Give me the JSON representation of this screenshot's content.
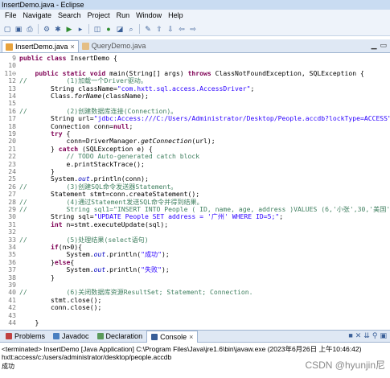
{
  "window": {
    "title": "InsertDemo.java - Eclipse"
  },
  "menu": [
    "File",
    "Navigate",
    "Search",
    "Project",
    "Run",
    "Window",
    "Help"
  ],
  "toolbar": {
    "icons": [
      "new-icon",
      "save-icon",
      "print-icon",
      "build-icon",
      "debug-icon",
      "run-icon",
      "external-tools-icon",
      "new-package-icon",
      "new-class-icon",
      "open-type-icon",
      "search-icon",
      "edit-icon",
      "prev-annotation-icon",
      "next-annotation-icon",
      "back-icon",
      "forward-icon"
    ]
  },
  "editor_tabs": [
    {
      "label": "InsertDemo.java",
      "active": true
    },
    {
      "label": "QueryDemo.java",
      "active": false
    }
  ],
  "code_lines": [
    {
      "n": "9",
      "html": "<span class=\"kw\">public class</span> InsertDemo {"
    },
    {
      "n": "10",
      "html": ""
    },
    {
      "n": "11⊖",
      "html": "    <span class=\"kw\">public static void</span> main(String[] args) <span class=\"kw\">throws</span> ClassNotFoundException, SQLException {"
    },
    {
      "n": "12",
      "html": "<span class=\"cm\">//          (1)加载一个Driver驱动。</span>"
    },
    {
      "n": "13",
      "html": "        String <span class=\"fld\" style=\"font-style:normal;color:#000\">className</span>=<span class=\"st\">\"com.hxtt.sql.access.AccessDriver\"</span>;"
    },
    {
      "n": "14",
      "html": "        Class.<span class=\"mth\">forName</span>(className);"
    },
    {
      "n": "15",
      "html": ""
    },
    {
      "n": "16",
      "html": "<span class=\"cm\">//          (2)创建数据库连接(Connection)。</span>"
    },
    {
      "n": "17",
      "html": "        String url=<span class=\"st\">\"jdbc:Access:///C:/Users/Administrator/Desktop/People.accdb?lockType=ACCESS\"</span>;"
    },
    {
      "n": "18",
      "html": "        Connection conn=<span class=\"kw\">null</span>;"
    },
    {
      "n": "19",
      "html": "        <span class=\"kw\">try</span> {"
    },
    {
      "n": "20",
      "html": "            conn=DriverManager.<span class=\"mth\">getConnection</span>(url);"
    },
    {
      "n": "21",
      "html": "        } <span class=\"kw\">catch</span> (SQLException e) {"
    },
    {
      "n": "22",
      "html": "            <span class=\"cm\">// TODO Auto-generated catch block</span>"
    },
    {
      "n": "23",
      "html": "            e.printStackTrace();"
    },
    {
      "n": "24",
      "html": "        }"
    },
    {
      "n": "25",
      "html": "        System.<span class=\"fld\">out</span>.println(conn);"
    },
    {
      "n": "26",
      "html": "<span class=\"cm\">//          (3)创建SQL命令发送器Statement。</span>"
    },
    {
      "n": "27",
      "html": "        Statement stmt=conn.createStatement();"
    },
    {
      "n": "28",
      "html": "<span class=\"cm\">//          (4)通过Statement发送SQL命令并得到结果。</span>"
    },
    {
      "n": "29",
      "html": "<span class=\"cm\">//          String sql1=\"INSERT INTO People ( ID, name, age, address )VALUES (6,'小张',30,'美国')\";</span>"
    },
    {
      "n": "30",
      "html": "        String sql=<span class=\"st\">\"UPDATE People SET address = '广州' WHERE ID=5;\"</span>;"
    },
    {
      "n": "31",
      "html": "        <span class=\"kw\">int</span> n=stmt.executeUpdate(sql);"
    },
    {
      "n": "32",
      "html": ""
    },
    {
      "n": "33",
      "html": "<span class=\"cm\">//          (5)处理结果(select语句)</span>"
    },
    {
      "n": "34",
      "html": "        <span class=\"kw\">if</span>(n&gt;0){"
    },
    {
      "n": "35",
      "html": "            System.<span class=\"fld\">out</span>.println(<span class=\"st\">\"成功\"</span>);"
    },
    {
      "n": "36",
      "html": "        }<span class=\"kw\">else</span>{"
    },
    {
      "n": "37",
      "html": "            System.<span class=\"fld\">out</span>.println(<span class=\"st\">\"失败\"</span>);"
    },
    {
      "n": "38",
      "html": "        }"
    },
    {
      "n": "39",
      "html": ""
    },
    {
      "n": "40",
      "html": "<span class=\"cm\">//          (6)关闭数据库资源ResultSet; Statement; Connection.</span>"
    },
    {
      "n": "41",
      "html": "        stmt.close();"
    },
    {
      "n": "42",
      "html": "        conn.close();"
    },
    {
      "n": "43",
      "html": ""
    },
    {
      "n": "44",
      "html": "    }"
    }
  ],
  "bottom_tabs": [
    {
      "label": "Problems",
      "icon": "problems-icon",
      "color": "#c04040",
      "active": false
    },
    {
      "label": "Javadoc",
      "icon": "javadoc-icon",
      "color": "#4a7fc0",
      "active": false
    },
    {
      "label": "Declaration",
      "icon": "declaration-icon",
      "color": "#5a9a5a",
      "active": false
    },
    {
      "label": "Console",
      "icon": "console-icon",
      "color": "#3a5f98",
      "active": true
    }
  ],
  "console": {
    "status": "<terminated> InsertDemo [Java Application] C:\\Program Files\\Java\\jre1.6\\bin\\javaw.exe (2023年6月26日 上午10:46:42)",
    "output1": "hxtt:access/c:/users/administrator/desktop/people.accdb",
    "output2": "成功"
  },
  "watermark": "CSDN @hyunjin尼",
  "colors": {
    "keyword": "#7f0055",
    "string": "#2a00ff",
    "comment": "#3f7f5f",
    "field": "#0000c0",
    "line_number": "#787878"
  }
}
